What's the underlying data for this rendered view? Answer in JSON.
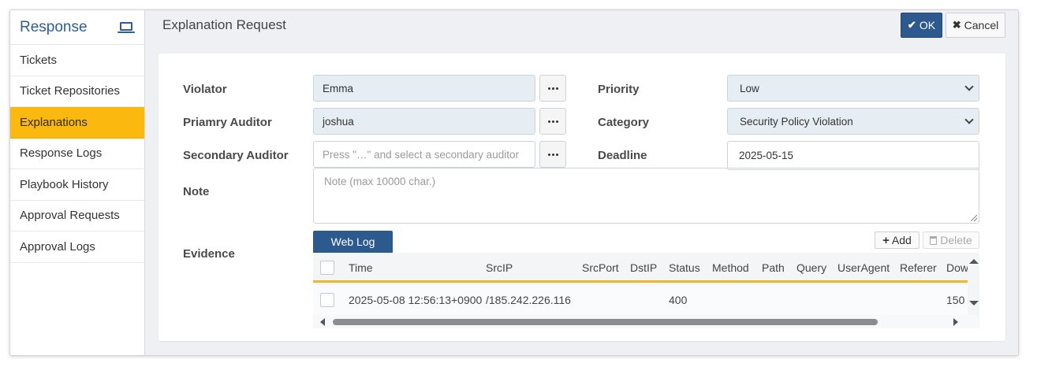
{
  "sidebar": {
    "title": "Response",
    "icon": "laptop-icon",
    "items": [
      {
        "label": "Tickets",
        "active": false
      },
      {
        "label": "Ticket Repositories",
        "active": false
      },
      {
        "label": "Explanations",
        "active": true
      },
      {
        "label": "Response Logs",
        "active": false
      },
      {
        "label": "Playbook History",
        "active": false
      },
      {
        "label": "Approval Requests",
        "active": false
      },
      {
        "label": "Approval Logs",
        "active": false
      }
    ]
  },
  "header": {
    "title": "Explanation Request",
    "ok_label": "OK",
    "cancel_label": "Cancel"
  },
  "form": {
    "violator": {
      "label": "Violator",
      "value": "Emma"
    },
    "primary_auditor": {
      "label": "Priamry Auditor",
      "value": "joshua"
    },
    "secondary_auditor": {
      "label": "Secondary Auditor",
      "placeholder": "Press \"…\" and select a secondary auditor"
    },
    "priority": {
      "label": "Priority",
      "value": "Low"
    },
    "category": {
      "label": "Category",
      "value": "Security Policy Violation"
    },
    "deadline": {
      "label": "Deadline",
      "value": "2025-05-15"
    },
    "note": {
      "label": "Note",
      "placeholder": "Note (max 10000 char.)"
    },
    "evidence": {
      "label": "Evidence"
    }
  },
  "evidence": {
    "tab_label": "Web Log",
    "add_label": "Add",
    "delete_label": "Delete",
    "columns": [
      "Time",
      "SrcIP",
      "SrcPort",
      "DstIP",
      "Status",
      "Method",
      "Path",
      "Query",
      "UserAgent",
      "Referer",
      "Dow"
    ],
    "rows": [
      {
        "Time": "2025-05-08 12:56:13+0900",
        "SrcIP": "/185.242.226.116",
        "SrcPort": "",
        "DstIP": "",
        "Status": "400",
        "Method": "",
        "Path": "",
        "Query": "",
        "UserAgent": "",
        "Referer": "",
        "Dow": "150"
      }
    ]
  },
  "colors": {
    "accent_blue": "#2d5a8e",
    "active_yellow": "#fbb80e",
    "header_underline": "#f5b623"
  }
}
